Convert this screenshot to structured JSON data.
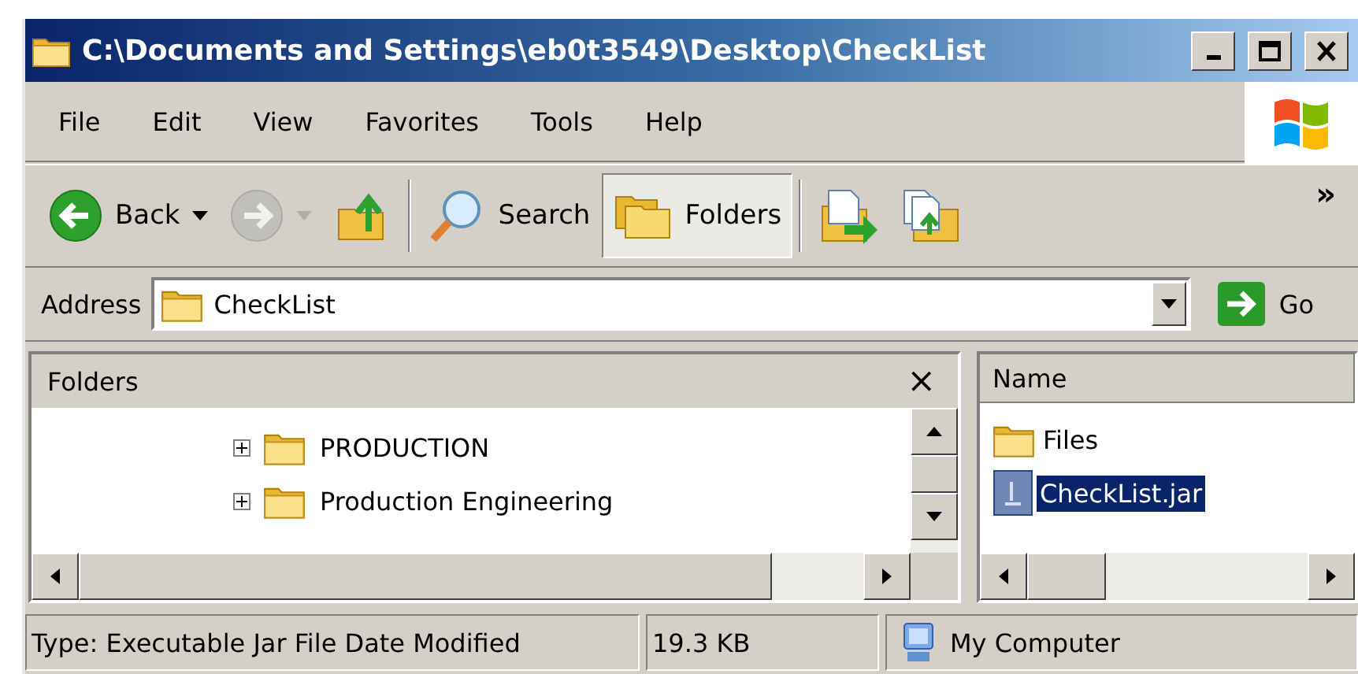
{
  "window": {
    "title": "C:\\Documents and Settings\\eb0t3549\\Desktop\\CheckList"
  },
  "menu": [
    {
      "label": "File"
    },
    {
      "label": "Edit"
    },
    {
      "label": "View"
    },
    {
      "label": "Favorites"
    },
    {
      "label": "Tools"
    },
    {
      "label": "Help"
    }
  ],
  "toolbar": [
    {
      "kind": "back",
      "label": "Back",
      "disabled": false,
      "selected": false
    },
    {
      "kind": "forward",
      "disabled": true,
      "selected": false
    },
    {
      "kind": "up",
      "disabled": false,
      "selected": false
    },
    {
      "kind": "separator"
    },
    {
      "kind": "search",
      "label": "Search",
      "disabled": false,
      "selected": false
    },
    {
      "kind": "folders",
      "label": "Folders",
      "disabled": false,
      "selected": true
    },
    {
      "kind": "separator"
    },
    {
      "kind": "move",
      "disabled": false,
      "selected": false
    },
    {
      "kind": "copy",
      "disabled": false,
      "selected": false
    }
  ],
  "toolbar_overflow": "»",
  "address": {
    "label": "Address",
    "value": "CheckList",
    "go": "Go"
  },
  "folders_pane": {
    "title": "Folders",
    "close": "×",
    "tree": [
      {
        "label": "PRODUCTION",
        "expanded": false
      },
      {
        "label": "Production Engineering",
        "expanded": false
      }
    ]
  },
  "files_pane": {
    "column": "Name",
    "items": [
      {
        "name": "Files",
        "kind": "folder",
        "selected": false
      },
      {
        "name": "CheckList.jar",
        "kind": "jar",
        "selected": true
      }
    ]
  },
  "status_bar": [
    "Type: Executable Jar File Date Modified",
    "19.3 KB",
    "My Computer"
  ]
}
